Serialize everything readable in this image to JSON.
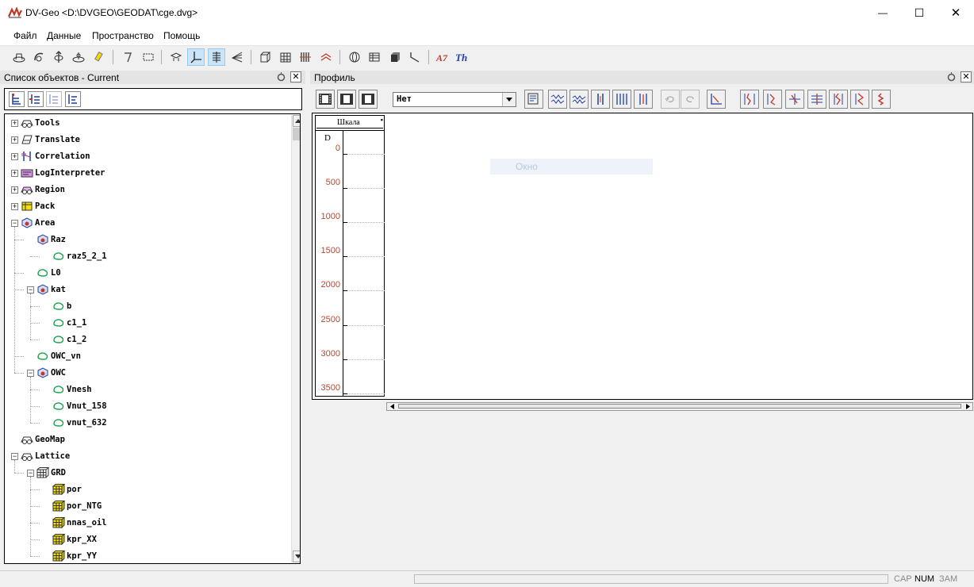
{
  "window": {
    "title": "DV-Geo  <D:\\DVGEO\\GEODAT\\cge.dvg>",
    "minimize_glyph": "—",
    "maximize_glyph": "☐",
    "close_glyph": "✕"
  },
  "menu": [
    "Файл",
    "Данные",
    "Пространство",
    "Помощь"
  ],
  "left_panel": {
    "title": "Список объектов - Current"
  },
  "tree": [
    {
      "label": "Tools",
      "level": 0,
      "expander": "+",
      "icon": "tools-icon"
    },
    {
      "label": "Translate",
      "level": 0,
      "expander": "+",
      "icon": "translate-icon"
    },
    {
      "label": "Correlation",
      "level": 0,
      "expander": "+",
      "icon": "correlation-icon"
    },
    {
      "label": "LogInterpreter",
      "level": 0,
      "expander": "+",
      "icon": "log-interpreter-icon"
    },
    {
      "label": "Region",
      "level": 0,
      "expander": "+",
      "icon": "region-icon"
    },
    {
      "label": "Pack",
      "level": 0,
      "expander": "+",
      "icon": "pack-icon"
    },
    {
      "label": "Area",
      "level": 0,
      "expander": "−",
      "icon": "area-icon"
    },
    {
      "label": "Raz",
      "level": 1,
      "expander": "",
      "icon": "area-icon"
    },
    {
      "label": "raz5_2_1",
      "level": 2,
      "expander": "",
      "icon": "contour-icon"
    },
    {
      "label": "L0",
      "level": 1,
      "expander": "",
      "icon": "contour-icon"
    },
    {
      "label": "kat",
      "level": 1,
      "expander": "−",
      "icon": "area-icon"
    },
    {
      "label": "b",
      "level": 2,
      "expander": "",
      "icon": "contour-icon"
    },
    {
      "label": "c1_1",
      "level": 2,
      "expander": "",
      "icon": "contour-icon"
    },
    {
      "label": "c1_2",
      "level": 2,
      "expander": "",
      "icon": "contour-icon"
    },
    {
      "label": "OWC_vn",
      "level": 1,
      "expander": "",
      "icon": "contour-icon"
    },
    {
      "label": "OWC",
      "level": 1,
      "expander": "−",
      "icon": "area-icon"
    },
    {
      "label": "Vnesh",
      "level": 2,
      "expander": "",
      "icon": "contour-icon"
    },
    {
      "label": "Vnut_158",
      "level": 2,
      "expander": "",
      "icon": "contour-icon"
    },
    {
      "label": "vnut_632",
      "level": 2,
      "expander": "",
      "icon": "contour-icon"
    },
    {
      "label": "GeoMap",
      "level": 0,
      "expander": "",
      "icon": "geomap-icon"
    },
    {
      "label": "Lattice",
      "level": 0,
      "expander": "−",
      "icon": "lattice-icon"
    },
    {
      "label": "GRD",
      "level": 1,
      "expander": "−",
      "icon": "grid-icon"
    },
    {
      "label": "por",
      "level": 2,
      "expander": "",
      "icon": "grid-cube-icon"
    },
    {
      "label": "por_NTG",
      "level": 2,
      "expander": "",
      "icon": "grid-cube-icon"
    },
    {
      "label": "nnas_oil",
      "level": 2,
      "expander": "",
      "icon": "grid-cube-icon"
    },
    {
      "label": "kpr_XX",
      "level": 2,
      "expander": "",
      "icon": "grid-cube-icon"
    },
    {
      "label": "kpr_YY",
      "level": 2,
      "expander": "",
      "icon": "grid-cube-icon"
    }
  ],
  "right_panel": {
    "title": "Профиль",
    "dropdown_value": "Нет",
    "window_hint": "Окно",
    "scale_header": "Шкала",
    "depth_axis_label": "D",
    "depth_ticks": [
      "0",
      "500",
      "1000",
      "1500",
      "2000",
      "2500",
      "3000",
      "3500"
    ]
  },
  "status": {
    "cap": "CAP",
    "num": "NUM",
    "zam": "ЗАМ"
  },
  "colors": {
    "depth_label": "#c0462a",
    "active_tool": "#cce4f7",
    "tree_border": "#000000"
  }
}
